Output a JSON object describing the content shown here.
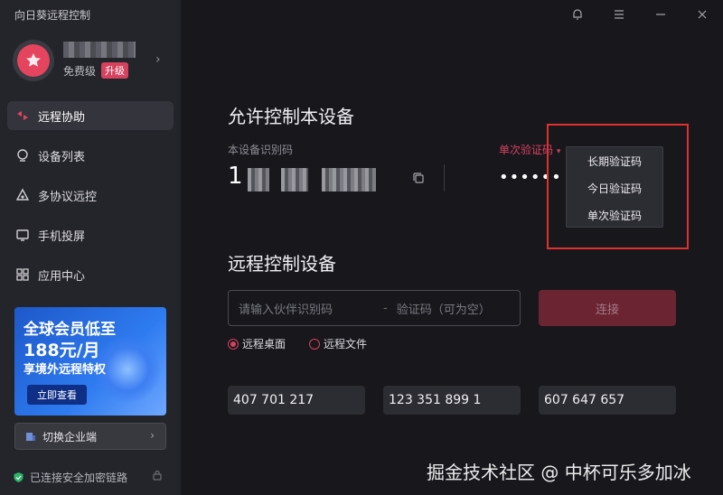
{
  "app": {
    "title": "向日葵远程控制"
  },
  "profile": {
    "level": "免费级",
    "upgrade": "升级"
  },
  "nav": [
    {
      "label": "远程协助",
      "icon": "remote-assist-icon",
      "active": true
    },
    {
      "label": "设备列表",
      "icon": "device-list-icon"
    },
    {
      "label": "多协议远控",
      "icon": "multi-protocol-icon"
    },
    {
      "label": "手机投屏",
      "icon": "screen-cast-icon"
    },
    {
      "label": "应用中心",
      "icon": "app-center-icon"
    }
  ],
  "promo": {
    "line1": "全球会员低至",
    "line2": "188元/月",
    "line3": "享境外远程特权",
    "button": "立即查看"
  },
  "enterprise": {
    "label": "切换企业端"
  },
  "security": {
    "status": "已连接安全加密链路"
  },
  "main": {
    "allow_title": "允许控制本设备",
    "device_id_label": "本设备识别码",
    "device_id_visible": "1",
    "code_type": "单次验证码",
    "code_masked": "••••••",
    "dropdown": [
      "长期验证码",
      "今日验证码",
      "单次验证码"
    ],
    "control_title": "远程控制设备",
    "partner_placeholder": "请输入伙伴识别码",
    "code_placeholder": "验证码（可为空）",
    "connect_label": "连接",
    "mode_desktop": "远程桌面",
    "mode_file": "远程文件",
    "recent": [
      "407 701 217",
      "123 351 899 1",
      "607 647 657"
    ]
  },
  "watermark": "掘金技术社区 @ 中杯可乐多加冰",
  "colors": {
    "accent": "#d6425e",
    "sidebar": "#24242b",
    "background": "#17171c"
  }
}
